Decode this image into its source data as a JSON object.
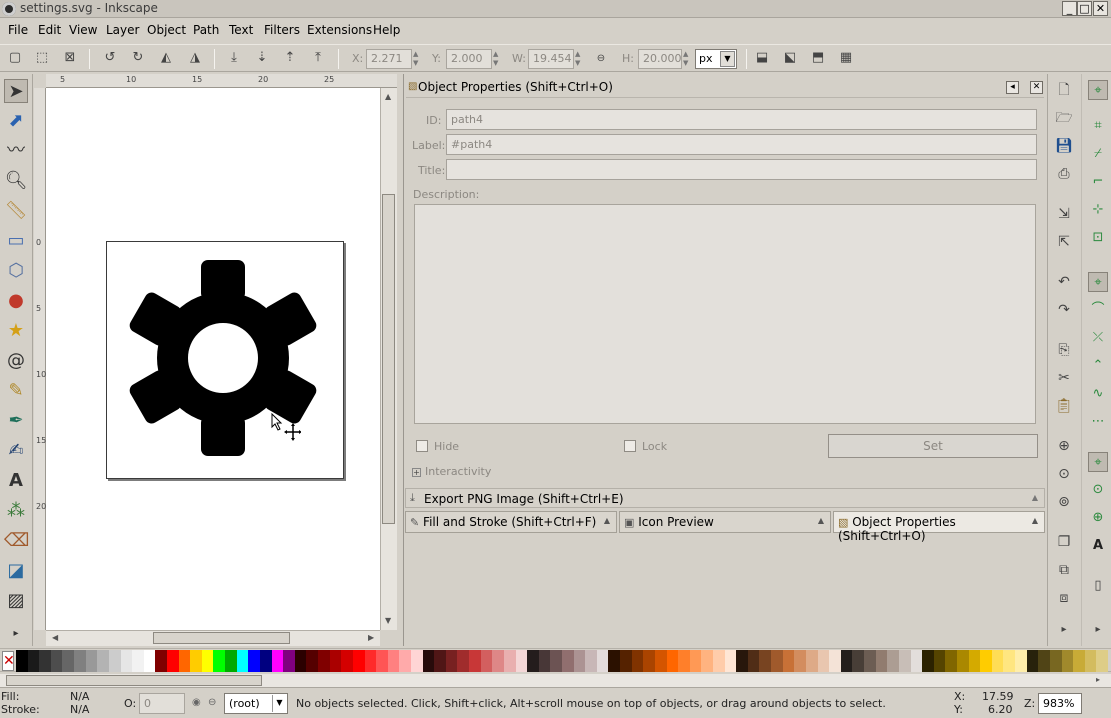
{
  "window": {
    "title": "settings.svg - Inkscape",
    "minimize": "_",
    "maximize": "□",
    "close": "✕"
  },
  "menu": [
    "File",
    "Edit",
    "View",
    "Layer",
    "Object",
    "Path",
    "Text",
    "Filters",
    "Extensions",
    "Help"
  ],
  "toolbar": {
    "x_label": "X:",
    "x_value": "2.271",
    "y_label": "Y:",
    "y_value": "2.000",
    "w_label": "W:",
    "w_value": "19.454",
    "h_label": "H:",
    "h_value": "20.000",
    "units": "px"
  },
  "ruler": {
    "h_ticks": [
      "5",
      "10",
      "15",
      "20",
      "25"
    ],
    "v_ticks": [
      "0",
      "5",
      "10",
      "15",
      "20"
    ]
  },
  "object_properties": {
    "panel_title": "Object Properties (Shift+Ctrl+O)",
    "id_label": "ID:",
    "id_value": "path4",
    "label_label": "Label:",
    "label_value": "#path4",
    "title_label": "Title:",
    "title_value": "",
    "description_label": "Description:",
    "hide_label": "Hide",
    "lock_label": "Lock",
    "set_label": "Set",
    "interactivity_label": "Interactivity"
  },
  "export_panel": {
    "title": "Export PNG Image (Shift+Ctrl+E)"
  },
  "tabs": [
    {
      "label": "Fill and Stroke (Shift+Ctrl+F)",
      "icon": "brush-icon"
    },
    {
      "label": "Icon Preview",
      "icon": "preview-icon"
    },
    {
      "label": "Object Properties (Shift+Ctrl+O)",
      "icon": "properties-icon"
    }
  ],
  "status": {
    "fill_label": "Fill:",
    "fill_value": "N/A",
    "stroke_label": "Stroke:",
    "stroke_value": "N/A",
    "opacity_label": "O:",
    "opacity_value": "0",
    "layer": "(root)",
    "message": "No objects selected. Click, Shift+click, Alt+scroll mouse on top of objects, or drag around objects to select.",
    "x_label": "X:",
    "x_value": "17.59",
    "y_label": "Y:",
    "y_value": "6.20",
    "zoom_label": "Z:",
    "zoom_value": "983%"
  },
  "palette_colors": [
    "#000000",
    "#1a1a1a",
    "#333333",
    "#4d4d4d",
    "#666666",
    "#808080",
    "#999999",
    "#b3b3b3",
    "#cccccc",
    "#e6e6e6",
    "#f2f2f2",
    "#ffffff",
    "#800000",
    "#ff0000",
    "#ff6600",
    "#ffcc00",
    "#ffff00",
    "#00ff00",
    "#00aa00",
    "#00ffff",
    "#0000ff",
    "#000080",
    "#ff00ff",
    "#800080",
    "#2b0000",
    "#550000",
    "#800000",
    "#aa0000",
    "#d40000",
    "#ff0000",
    "#ff2a2a",
    "#ff5555",
    "#ff8080",
    "#ffaaaa",
    "#ffd5d5",
    "#280b0b",
    "#501616",
    "#782121",
    "#a02c2c",
    "#c83737",
    "#d35f5f",
    "#de8787",
    "#e9afaf",
    "#f4d7d7",
    "#241c1c",
    "#483737",
    "#6c5353",
    "#916f6f",
    "#ac9393",
    "#c8b7b7",
    "#e3dbdb",
    "#2b1100",
    "#552200",
    "#803300",
    "#aa4400",
    "#d45500",
    "#ff6600",
    "#ff7f2a",
    "#ff9955",
    "#ffb380",
    "#ffccaa",
    "#ffe6d5",
    "#28170b",
    "#502d16",
    "#784421",
    "#a05a2c",
    "#c87137",
    "#d38d5f",
    "#deaa87",
    "#e9c6af",
    "#f4e3d7",
    "#241f1c",
    "#483e37",
    "#6c5d53",
    "#917c6f",
    "#ac9d93",
    "#c8beb7",
    "#e3dedb",
    "#2b2200",
    "#554400",
    "#806600",
    "#aa8800",
    "#d4aa00",
    "#ffcc00",
    "#ffdd55",
    "#ffe680",
    "#ffeeaa",
    "#28220b",
    "#504416",
    "#786721",
    "#a0892c",
    "#c8ab37",
    "#d3bc5f",
    "#decd87"
  ]
}
